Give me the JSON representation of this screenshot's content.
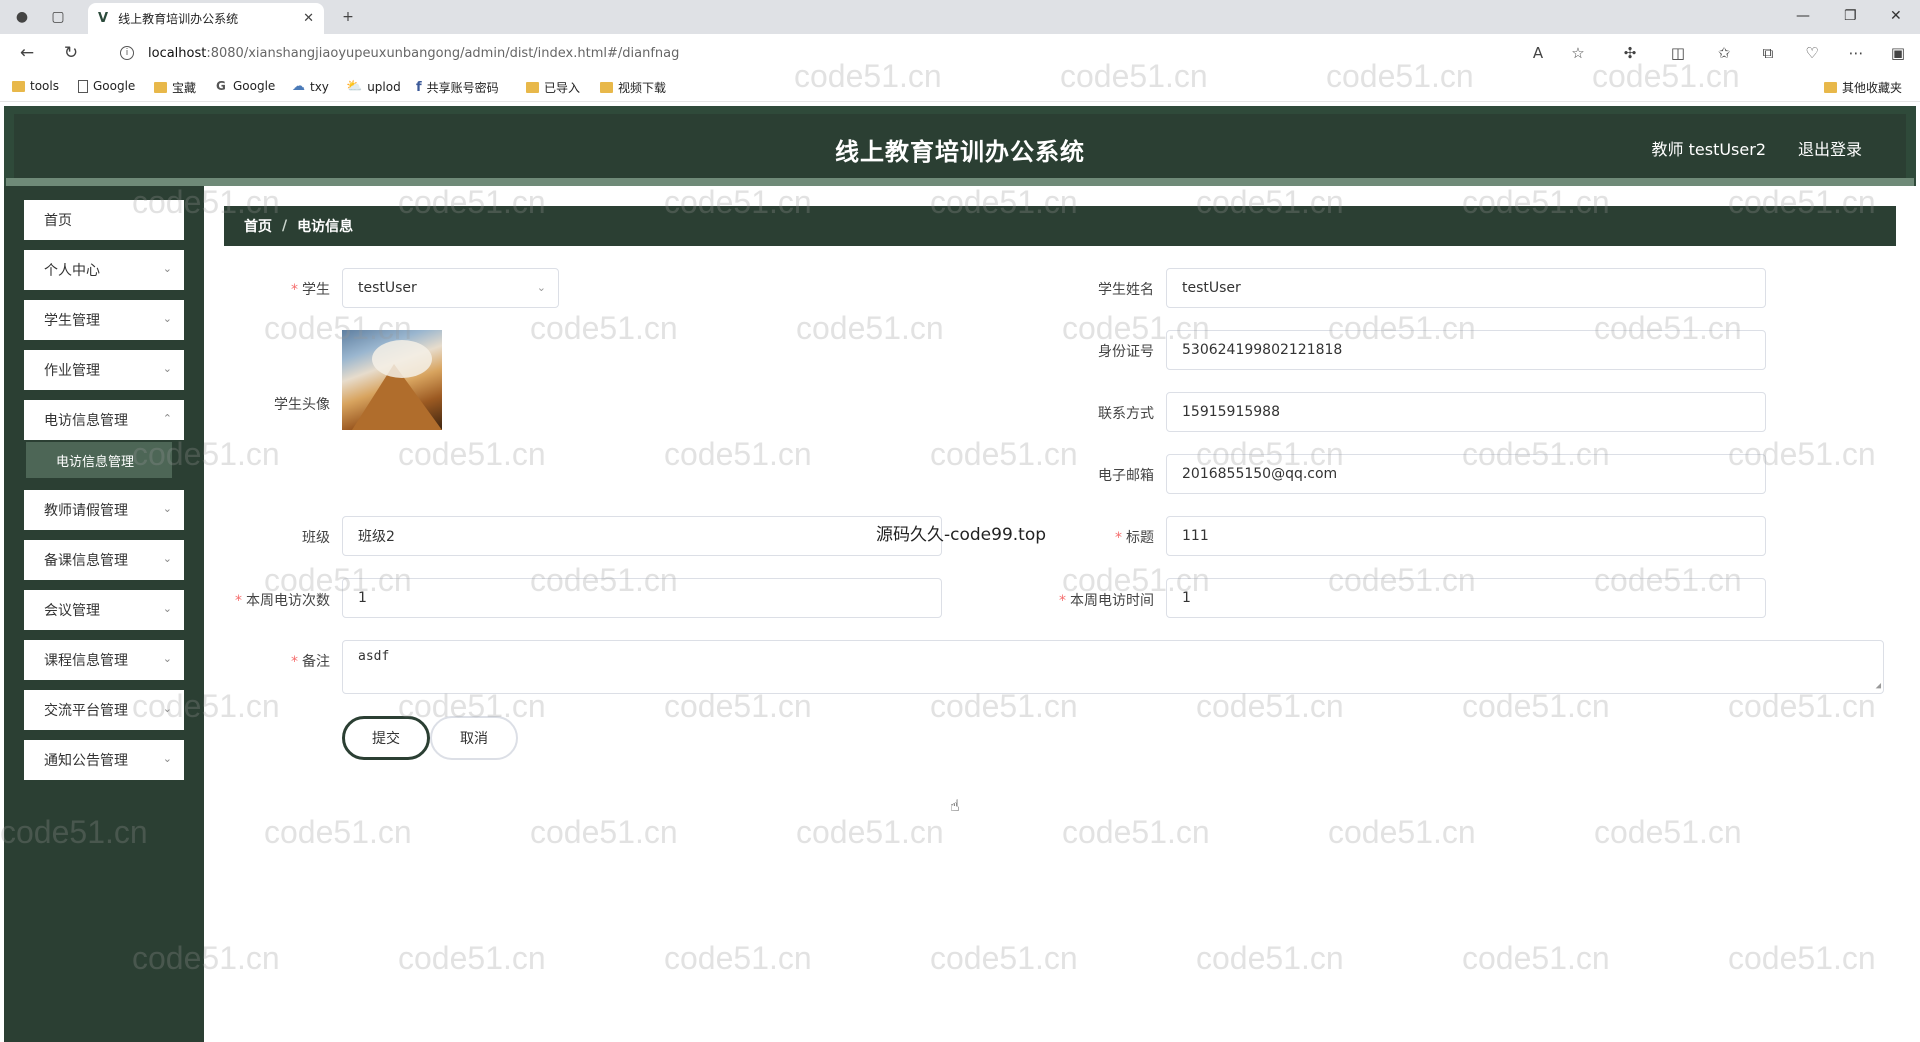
{
  "browser": {
    "tab_title": "线上教育培训办公系统",
    "url_host": "localhost",
    "url_rest": ":8080/xianshangjiaoyupeuxunbangong/admin/dist/index.html#/dianfnag",
    "bookmarks": [
      "tools",
      "Google",
      "宝藏",
      "Google",
      "txy",
      "uplod",
      "共享账号密码",
      "已导入",
      "视频下载"
    ],
    "other_bookmarks": "其他收藏夹"
  },
  "header": {
    "title": "线上教育培训办公系统",
    "user": "教师 testUser2",
    "logout": "退出登录"
  },
  "sidebar": {
    "items": [
      {
        "label": "首页",
        "has_chevron": false
      },
      {
        "label": "个人中心",
        "has_chevron": true
      },
      {
        "label": "学生管理",
        "has_chevron": true
      },
      {
        "label": "作业管理",
        "has_chevron": true
      },
      {
        "label": "电访信息管理",
        "has_chevron": true
      },
      {
        "label": "教师请假管理",
        "has_chevron": true
      },
      {
        "label": "备课信息管理",
        "has_chevron": true
      },
      {
        "label": "会议管理",
        "has_chevron": true
      },
      {
        "label": "课程信息管理",
        "has_chevron": true
      },
      {
        "label": "交流平台管理",
        "has_chevron": true
      },
      {
        "label": "通知公告管理",
        "has_chevron": true
      }
    ],
    "active_sub": "电访信息管理"
  },
  "breadcrumb": {
    "home": "首页",
    "sep": "/",
    "current": "电访信息"
  },
  "form": {
    "student": {
      "label": "学生",
      "value": "testUser"
    },
    "student_name": {
      "label": "学生姓名",
      "value": "testUser"
    },
    "id_number": {
      "label": "身份证号",
      "value": "530624199802121818"
    },
    "avatar": {
      "label": "学生头像"
    },
    "contact": {
      "label": "联系方式",
      "value": "15915915988"
    },
    "email": {
      "label": "电子邮箱",
      "value": "2016855150@qq.com"
    },
    "class": {
      "label": "班级",
      "value": "班级2"
    },
    "title": {
      "label": "标题",
      "value": "111"
    },
    "weekly_count": {
      "label": "本周电访次数",
      "value": "1"
    },
    "weekly_time": {
      "label": "本周电访时间",
      "value": "1"
    },
    "remark": {
      "label": "备注",
      "value": "asdf"
    },
    "submit": "提交",
    "cancel": "取消",
    "required_mark": "*"
  },
  "overlay_text": "源码久久-code99.top",
  "watermark": "code51.cn",
  "colors": {
    "primary": "#2b3f33",
    "frame": "#2f4a3a",
    "required": "#f56c6c",
    "sub_active": "#4d6656"
  }
}
